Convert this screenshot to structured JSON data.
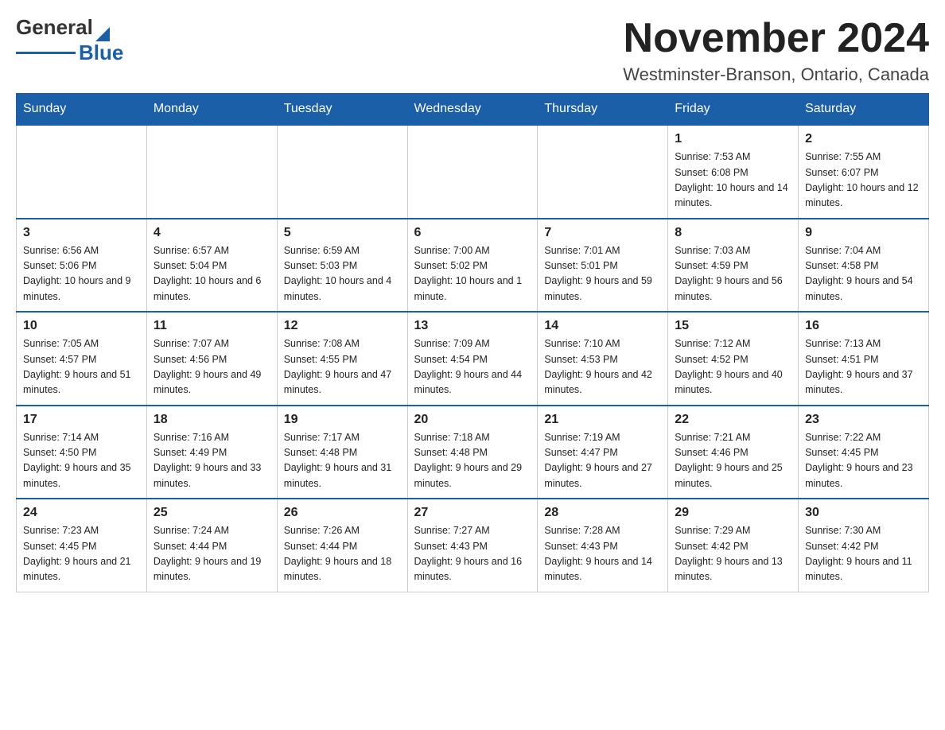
{
  "header": {
    "logo_general": "General",
    "logo_blue": "Blue",
    "month_title": "November 2024",
    "location": "Westminster-Branson, Ontario, Canada"
  },
  "weekdays": [
    "Sunday",
    "Monday",
    "Tuesday",
    "Wednesday",
    "Thursday",
    "Friday",
    "Saturday"
  ],
  "weeks": [
    [
      {
        "day": "",
        "empty": true
      },
      {
        "day": "",
        "empty": true
      },
      {
        "day": "",
        "empty": true
      },
      {
        "day": "",
        "empty": true
      },
      {
        "day": "",
        "empty": true
      },
      {
        "day": "1",
        "sunrise": "Sunrise: 7:53 AM",
        "sunset": "Sunset: 6:08 PM",
        "daylight": "Daylight: 10 hours and 14 minutes."
      },
      {
        "day": "2",
        "sunrise": "Sunrise: 7:55 AM",
        "sunset": "Sunset: 6:07 PM",
        "daylight": "Daylight: 10 hours and 12 minutes."
      }
    ],
    [
      {
        "day": "3",
        "sunrise": "Sunrise: 6:56 AM",
        "sunset": "Sunset: 5:06 PM",
        "daylight": "Daylight: 10 hours and 9 minutes."
      },
      {
        "day": "4",
        "sunrise": "Sunrise: 6:57 AM",
        "sunset": "Sunset: 5:04 PM",
        "daylight": "Daylight: 10 hours and 6 minutes."
      },
      {
        "day": "5",
        "sunrise": "Sunrise: 6:59 AM",
        "sunset": "Sunset: 5:03 PM",
        "daylight": "Daylight: 10 hours and 4 minutes."
      },
      {
        "day": "6",
        "sunrise": "Sunrise: 7:00 AM",
        "sunset": "Sunset: 5:02 PM",
        "daylight": "Daylight: 10 hours and 1 minute."
      },
      {
        "day": "7",
        "sunrise": "Sunrise: 7:01 AM",
        "sunset": "Sunset: 5:01 PM",
        "daylight": "Daylight: 9 hours and 59 minutes."
      },
      {
        "day": "8",
        "sunrise": "Sunrise: 7:03 AM",
        "sunset": "Sunset: 4:59 PM",
        "daylight": "Daylight: 9 hours and 56 minutes."
      },
      {
        "day": "9",
        "sunrise": "Sunrise: 7:04 AM",
        "sunset": "Sunset: 4:58 PM",
        "daylight": "Daylight: 9 hours and 54 minutes."
      }
    ],
    [
      {
        "day": "10",
        "sunrise": "Sunrise: 7:05 AM",
        "sunset": "Sunset: 4:57 PM",
        "daylight": "Daylight: 9 hours and 51 minutes."
      },
      {
        "day": "11",
        "sunrise": "Sunrise: 7:07 AM",
        "sunset": "Sunset: 4:56 PM",
        "daylight": "Daylight: 9 hours and 49 minutes."
      },
      {
        "day": "12",
        "sunrise": "Sunrise: 7:08 AM",
        "sunset": "Sunset: 4:55 PM",
        "daylight": "Daylight: 9 hours and 47 minutes."
      },
      {
        "day": "13",
        "sunrise": "Sunrise: 7:09 AM",
        "sunset": "Sunset: 4:54 PM",
        "daylight": "Daylight: 9 hours and 44 minutes."
      },
      {
        "day": "14",
        "sunrise": "Sunrise: 7:10 AM",
        "sunset": "Sunset: 4:53 PM",
        "daylight": "Daylight: 9 hours and 42 minutes."
      },
      {
        "day": "15",
        "sunrise": "Sunrise: 7:12 AM",
        "sunset": "Sunset: 4:52 PM",
        "daylight": "Daylight: 9 hours and 40 minutes."
      },
      {
        "day": "16",
        "sunrise": "Sunrise: 7:13 AM",
        "sunset": "Sunset: 4:51 PM",
        "daylight": "Daylight: 9 hours and 37 minutes."
      }
    ],
    [
      {
        "day": "17",
        "sunrise": "Sunrise: 7:14 AM",
        "sunset": "Sunset: 4:50 PM",
        "daylight": "Daylight: 9 hours and 35 minutes."
      },
      {
        "day": "18",
        "sunrise": "Sunrise: 7:16 AM",
        "sunset": "Sunset: 4:49 PM",
        "daylight": "Daylight: 9 hours and 33 minutes."
      },
      {
        "day": "19",
        "sunrise": "Sunrise: 7:17 AM",
        "sunset": "Sunset: 4:48 PM",
        "daylight": "Daylight: 9 hours and 31 minutes."
      },
      {
        "day": "20",
        "sunrise": "Sunrise: 7:18 AM",
        "sunset": "Sunset: 4:48 PM",
        "daylight": "Daylight: 9 hours and 29 minutes."
      },
      {
        "day": "21",
        "sunrise": "Sunrise: 7:19 AM",
        "sunset": "Sunset: 4:47 PM",
        "daylight": "Daylight: 9 hours and 27 minutes."
      },
      {
        "day": "22",
        "sunrise": "Sunrise: 7:21 AM",
        "sunset": "Sunset: 4:46 PM",
        "daylight": "Daylight: 9 hours and 25 minutes."
      },
      {
        "day": "23",
        "sunrise": "Sunrise: 7:22 AM",
        "sunset": "Sunset: 4:45 PM",
        "daylight": "Daylight: 9 hours and 23 minutes."
      }
    ],
    [
      {
        "day": "24",
        "sunrise": "Sunrise: 7:23 AM",
        "sunset": "Sunset: 4:45 PM",
        "daylight": "Daylight: 9 hours and 21 minutes."
      },
      {
        "day": "25",
        "sunrise": "Sunrise: 7:24 AM",
        "sunset": "Sunset: 4:44 PM",
        "daylight": "Daylight: 9 hours and 19 minutes."
      },
      {
        "day": "26",
        "sunrise": "Sunrise: 7:26 AM",
        "sunset": "Sunset: 4:44 PM",
        "daylight": "Daylight: 9 hours and 18 minutes."
      },
      {
        "day": "27",
        "sunrise": "Sunrise: 7:27 AM",
        "sunset": "Sunset: 4:43 PM",
        "daylight": "Daylight: 9 hours and 16 minutes."
      },
      {
        "day": "28",
        "sunrise": "Sunrise: 7:28 AM",
        "sunset": "Sunset: 4:43 PM",
        "daylight": "Daylight: 9 hours and 14 minutes."
      },
      {
        "day": "29",
        "sunrise": "Sunrise: 7:29 AM",
        "sunset": "Sunset: 4:42 PM",
        "daylight": "Daylight: 9 hours and 13 minutes."
      },
      {
        "day": "30",
        "sunrise": "Sunrise: 7:30 AM",
        "sunset": "Sunset: 4:42 PM",
        "daylight": "Daylight: 9 hours and 11 minutes."
      }
    ]
  ]
}
